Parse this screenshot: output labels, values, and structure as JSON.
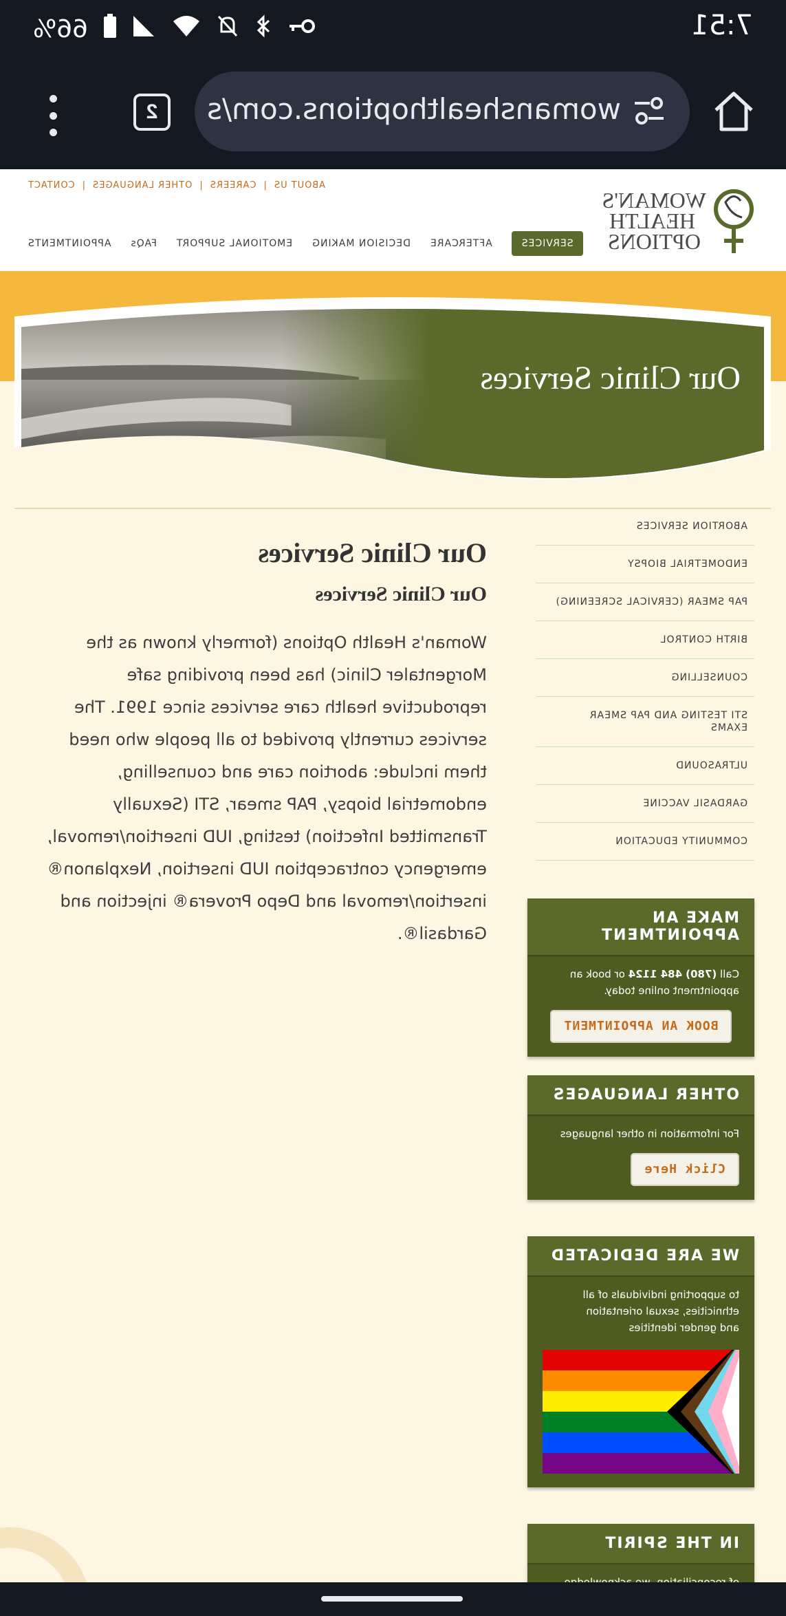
{
  "status_bar": {
    "time": "7:51",
    "battery": "66%"
  },
  "browser": {
    "url": "womanshealthoptions.com/s",
    "tab_count": "2"
  },
  "site": {
    "logo_lines": [
      "WOMAN'S",
      "HEALTH",
      "OPTIONS"
    ],
    "top_links": [
      "ABOUT US",
      "CAREERS",
      "OTHER LANGUAGES",
      "CONTACT"
    ],
    "main_nav": [
      "SERVICES",
      "AFTERCARE",
      "DECISION MAKING",
      "EMOTIONAL SUPPORT",
      "FAQs",
      "APPOINTMENTS"
    ],
    "hero_title": "Our Clinic Services"
  },
  "sidenav": [
    "ABORTION SERVICES",
    "ENDOMETRIAL BIOPSY",
    "PAP SMEAR (CERVICAL SCREENING)",
    "BIRTH CONTROL",
    "COUNSELLING",
    "STI TESTING AND PAP SMEAR EXAMS",
    "ULTRASOUND",
    "GARDASIL VACCINE",
    "COMMUNITY EDUCATION"
  ],
  "main": {
    "h1": "Our Clinic Services",
    "h2": "Our Clinic Services",
    "paragraph": "Woman's Health Options (formerly known as the Morgentaler Clinic) has been providing safe reproductive health care services since 1991. The services currently provided to all people who need them include: abortion care and counselling, endometrial biopsy, PAP smear, STI (Sexually Transmitted Infection) testing, IUD insertion/removal, emergency contraception IUD insertion, Nexplanon® insertion/removal and Depo Provera® injection and Gardasil®."
  },
  "boxes": {
    "appointment": {
      "title": "MAKE AN APPOINTMENT",
      "text_pre": "Call ",
      "phone": "(780) 484 1124",
      "text_post": " or book an appointment online today.",
      "button": "BOOK AN APPOINTMENT"
    },
    "languages": {
      "title": "OTHER LANGUAGES",
      "text": "For information in other languages",
      "button": "Click Here"
    },
    "dedicated": {
      "title": "WE ARE DEDICATED",
      "text": "to supporting individuals of all ethnicities, sexual orientation and gender identities"
    },
    "spirit": {
      "title": "IN THE SPIRIT",
      "text": "of reconciliation, we acknowledge that"
    }
  },
  "colors": {
    "olive": "#5b6a2b",
    "orange": "#f6b73d",
    "accent_text": "#c66a1a"
  }
}
